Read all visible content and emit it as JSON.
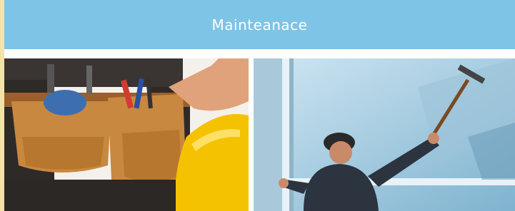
{
  "header": {
    "title": "Mainteanace"
  },
  "photos": [
    {
      "subject": "tool-belt-worker-icon"
    },
    {
      "subject": "window-cleaner-icon"
    }
  ],
  "colors": {
    "header_bg": "#7dc4e6",
    "accent": "#f3e3a6",
    "leather": "#c9883f",
    "helmet": "#f5c200"
  }
}
